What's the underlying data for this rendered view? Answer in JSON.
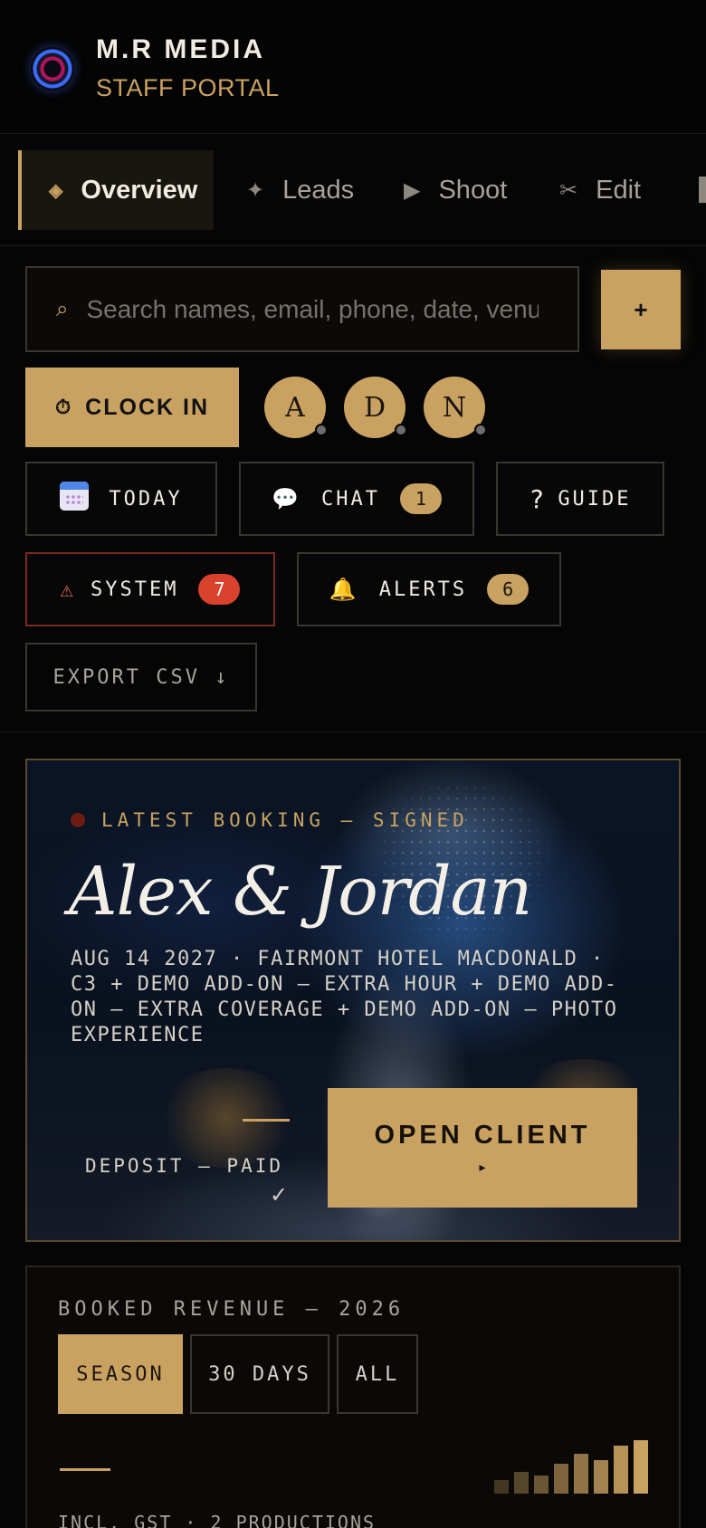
{
  "header": {
    "brand": "M.R MEDIA",
    "subtitle": "STAFF PORTAL"
  },
  "tabs": [
    {
      "label": "Overview",
      "icon": "diamond-icon",
      "active": true
    },
    {
      "label": "Leads",
      "icon": "sparkle-icon"
    },
    {
      "label": "Shoot",
      "icon": "play-icon"
    },
    {
      "label": "Edit",
      "icon": "scissors-icon"
    }
  ],
  "search": {
    "placeholder": "Search names, email, phone, date, venue",
    "value": ""
  },
  "add_label": "+",
  "clock": {
    "label": "CLOCK IN",
    "icon": "stopwatch-icon"
  },
  "staff": [
    {
      "initial": "A",
      "status": "offline"
    },
    {
      "initial": "D",
      "status": "offline"
    },
    {
      "initial": "N",
      "status": "offline"
    }
  ],
  "actions": {
    "today": {
      "label": "TODAY",
      "icon": "calendar-icon"
    },
    "chat": {
      "label": "CHAT",
      "icon": "speech-bubble-icon",
      "count": "1"
    },
    "guide": {
      "label": "GUIDE",
      "icon": "question-icon"
    },
    "system": {
      "label": "SYSTEM",
      "icon": "warning-icon",
      "count": "7"
    },
    "alerts": {
      "label": "ALERTS",
      "icon": "bell-icon",
      "count": "6"
    },
    "export": {
      "label": "EXPORT CSV ↓"
    }
  },
  "booking": {
    "eyebrow": "LATEST BOOKING — SIGNED",
    "couple": "Alex & Jordan",
    "details": "AUG 14 2027 · FAIRMONT HOTEL MACDONALD · C3 + DEMO ADD-ON — EXTRA HOUR + DEMO ADD-ON — EXTRA COVERAGE + DEMO ADD-ON — PHOTO EXPERIENCE",
    "deposit": "DEPOSIT — PAID",
    "deposit_check": "✓",
    "open_label": "OPEN CLIENT",
    "open_arrow": "▸"
  },
  "revenue": {
    "title": "BOOKED REVENUE — 2026",
    "ranges": [
      "SEASON",
      "30 DAYS",
      "ALL"
    ],
    "active_range": "SEASON",
    "meta": "INCL. GST · 2 PRODUCTIONS",
    "trend_bars": [
      0.22,
      0.36,
      0.3,
      0.5,
      0.66,
      0.56,
      0.8,
      0.9
    ]
  },
  "colors": {
    "accent": "#c9a261",
    "background": "#050505",
    "danger": "#d8422c"
  }
}
